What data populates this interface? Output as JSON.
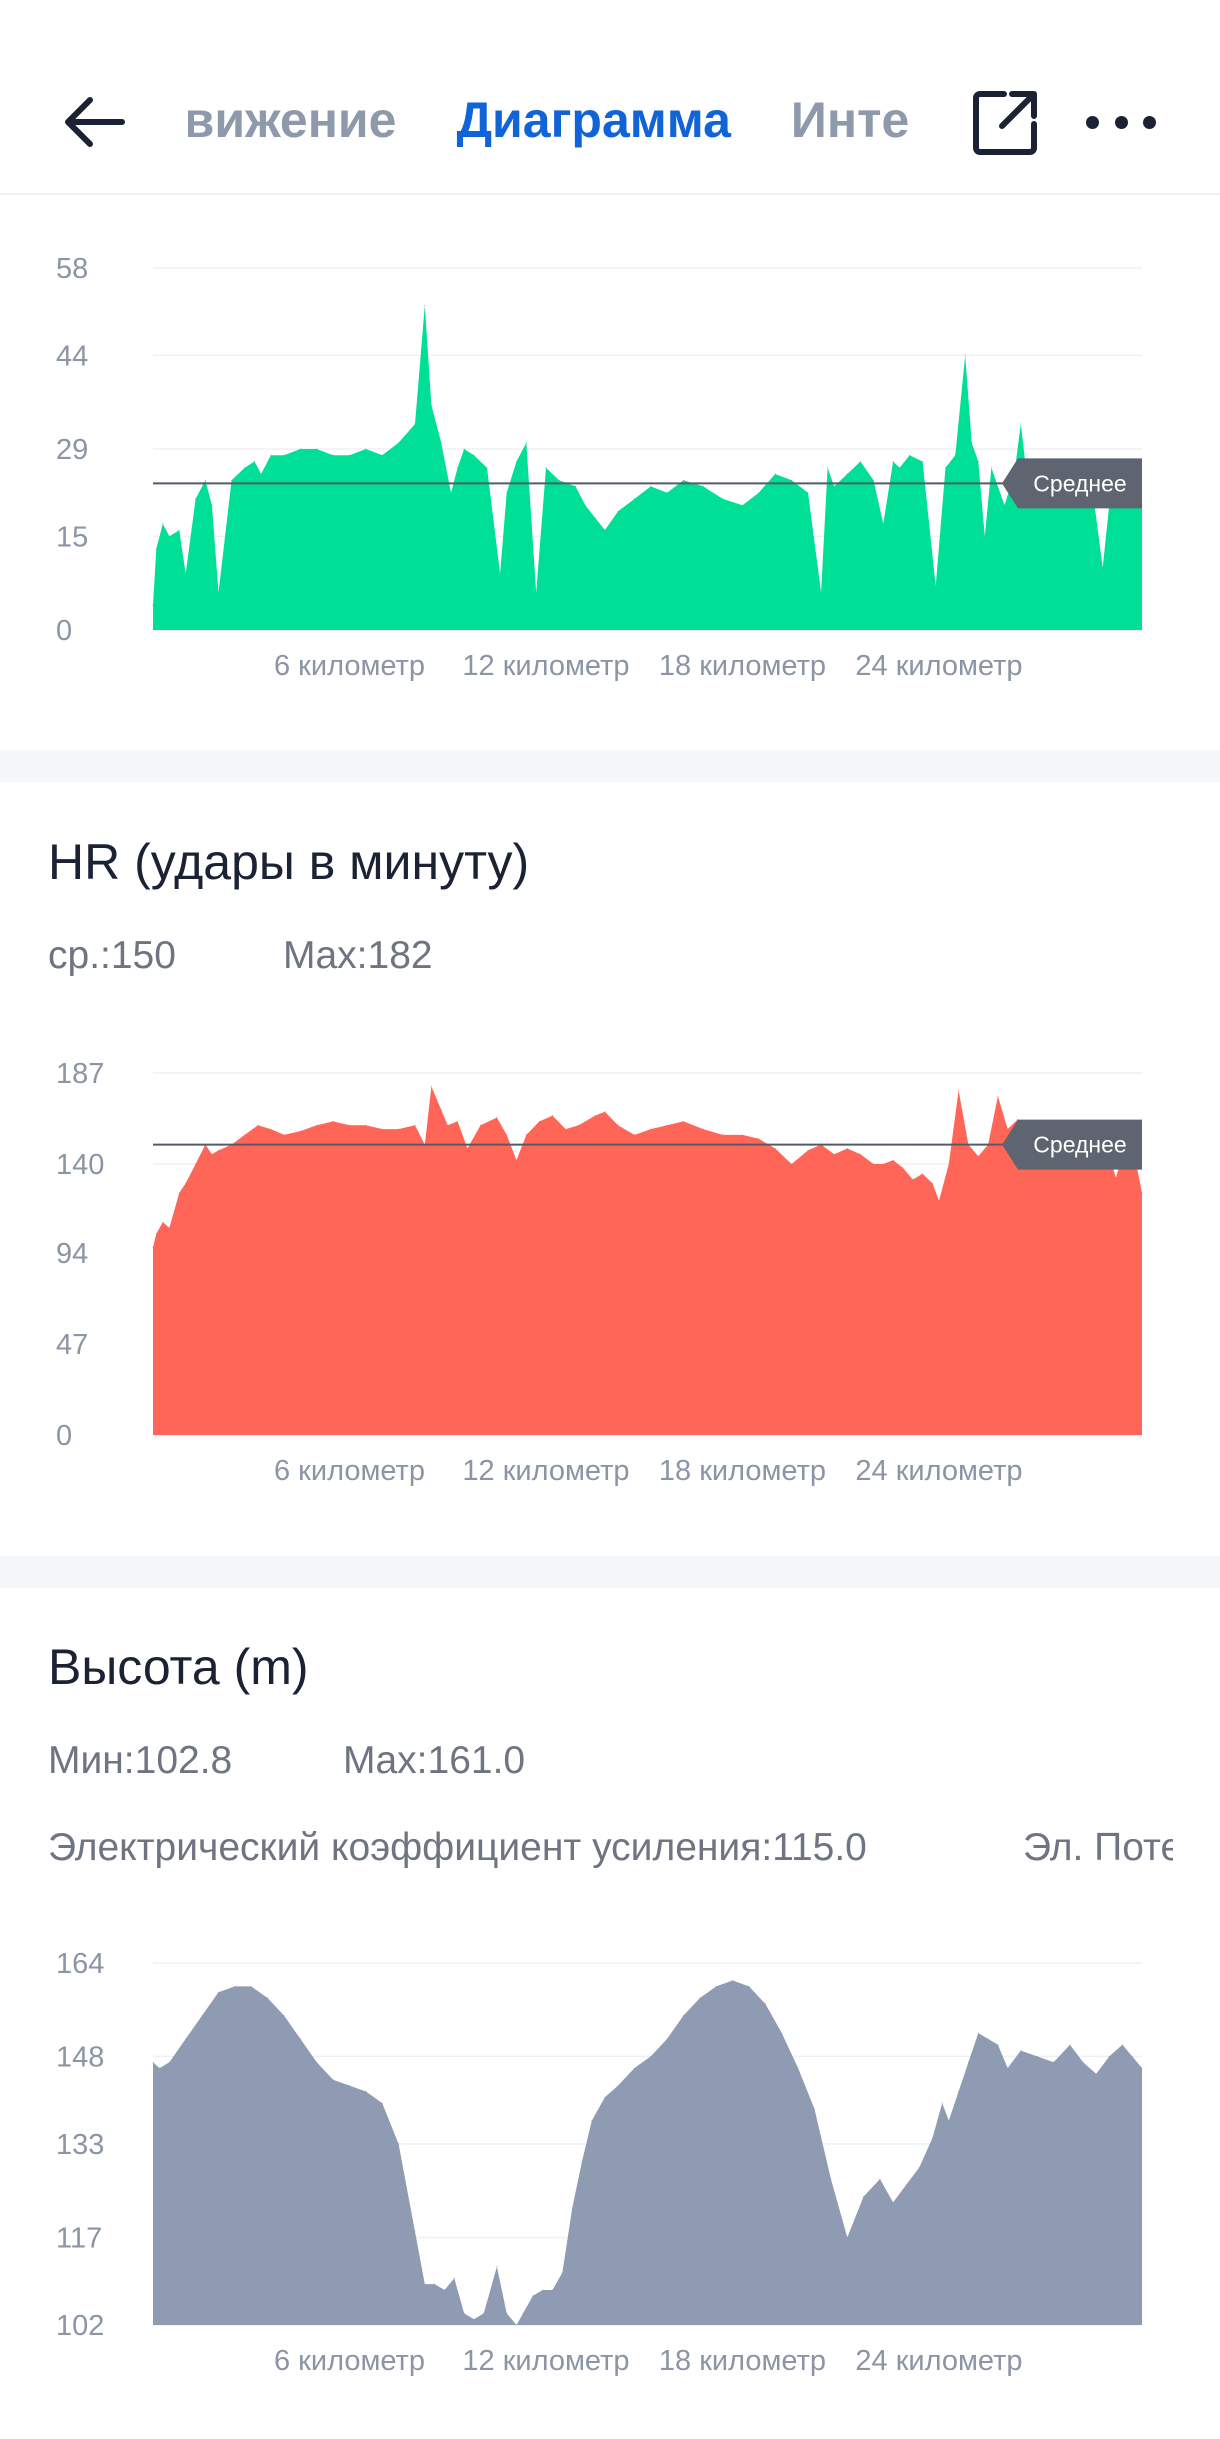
{
  "header": {
    "tabs": [
      {
        "label": "Движение",
        "active": false
      },
      {
        "label": "Диаграмма",
        "active": true
      },
      {
        "label": "Интервалы",
        "active": false
      }
    ],
    "back_icon": "arrow-left-icon",
    "share_icon": "external-share-icon",
    "more_icon": "more-dots-icon"
  },
  "hr": {
    "title": "HR (удары в минуту)",
    "avg_text": "ср.:150",
    "max_text": "Max:182"
  },
  "altitude": {
    "title": "Высота (m)",
    "min_text": "Мин:102.8",
    "max_text": "Max:161.0",
    "gain_text": "Электрический коэффициент усиления:115.0",
    "loss_text": "Эл. Поте"
  },
  "chart_data": [
    {
      "type": "area",
      "id": "speed",
      "color": "#00df96",
      "yticks": [
        0,
        15,
        29,
        44,
        58
      ],
      "ylim": [
        0,
        58
      ],
      "xlim": [
        0,
        30.2
      ],
      "xticks": [
        6,
        12,
        18,
        24
      ],
      "xtick_labels": [
        "6 километр",
        "12 километр",
        "18 километр",
        "24 километр"
      ],
      "average": 23.5,
      "average_label": "Среднее",
      "x": [
        0,
        0.1,
        0.3,
        0.5,
        0.8,
        1.0,
        1.3,
        1.6,
        1.8,
        2.0,
        2.4,
        2.8,
        3.1,
        3.3,
        3.6,
        4.0,
        4.5,
        5.0,
        5.5,
        6.0,
        6.5,
        7.0,
        7.5,
        8.0,
        8.3,
        8.5,
        8.8,
        9.1,
        9.3,
        9.5,
        9.8,
        10.2,
        10.6,
        10.8,
        11.1,
        11.4,
        11.7,
        12.0,
        12.4,
        12.9,
        13.2,
        13.5,
        13.8,
        14.2,
        14.7,
        15.2,
        15.7,
        16.2,
        16.8,
        17.4,
        18.0,
        18.5,
        19.0,
        19.5,
        20.0,
        20.4,
        20.6,
        20.8,
        21.2,
        21.6,
        22.0,
        22.3,
        22.6,
        22.8,
        23.1,
        23.5,
        23.9,
        24.2,
        24.5,
        24.8,
        25.0,
        25.2,
        25.4,
        25.6,
        26.0,
        26.3,
        26.5,
        26.7,
        26.9,
        27.2,
        27.6,
        27.9,
        28.1,
        28.4,
        28.7,
        29.0,
        29.3,
        29.5,
        29.8,
        30.0,
        30.2
      ],
      "y": [
        4,
        13,
        17,
        15,
        16,
        9,
        21,
        24,
        20,
        6,
        24,
        26,
        27,
        25,
        28,
        28,
        29,
        29,
        28,
        28,
        29,
        28,
        30,
        33,
        52,
        36,
        30,
        22,
        26,
        29,
        28,
        26,
        9,
        22,
        27,
        30,
        6,
        26,
        24,
        23,
        20,
        18,
        16,
        19,
        21,
        23,
        22,
        24,
        23,
        21,
        20,
        22,
        25,
        24,
        22,
        6,
        26,
        23,
        25,
        27,
        24,
        17,
        27,
        26,
        28,
        27,
        7,
        26,
        28,
        44,
        30,
        27,
        15,
        26,
        20,
        25,
        33,
        24,
        22,
        24,
        21,
        24,
        20,
        26,
        22,
        10,
        25,
        20,
        24,
        22,
        20
      ]
    },
    {
      "type": "area",
      "id": "hr",
      "color": "#ff6657",
      "yticks": [
        0,
        47,
        94,
        140,
        187
      ],
      "ylim": [
        0,
        187
      ],
      "xlim": [
        0,
        30.2
      ],
      "xticks": [
        6,
        12,
        18,
        24
      ],
      "xtick_labels": [
        "6 километр",
        "12 километр",
        "18 километр",
        "24 километр"
      ],
      "average": 150,
      "average_label": "Среднее",
      "x": [
        0,
        0.1,
        0.3,
        0.5,
        0.8,
        1.0,
        1.3,
        1.6,
        1.8,
        2.0,
        2.4,
        2.8,
        3.2,
        3.6,
        4.0,
        4.5,
        5.0,
        5.5,
        6.0,
        6.5,
        7.0,
        7.5,
        8.0,
        8.3,
        8.5,
        8.8,
        9.0,
        9.3,
        9.6,
        10.0,
        10.5,
        10.8,
        11.1,
        11.4,
        11.8,
        12.2,
        12.6,
        13.0,
        13.5,
        13.8,
        14.2,
        14.7,
        15.2,
        15.7,
        16.2,
        16.8,
        17.4,
        18.0,
        18.5,
        19.0,
        19.5,
        20.0,
        20.4,
        20.8,
        21.2,
        21.6,
        22.0,
        22.3,
        22.6,
        22.9,
        23.2,
        23.5,
        23.8,
        24.0,
        24.3,
        24.6,
        24.9,
        25.2,
        25.5,
        25.8,
        26.1,
        26.4,
        26.7,
        27.0,
        27.3,
        27.7,
        28.0,
        28.4,
        28.8,
        29.1,
        29.4,
        29.7,
        30.0,
        30.2
      ],
      "y": [
        97,
        104,
        110,
        107,
        125,
        130,
        140,
        150,
        145,
        147,
        150,
        155,
        160,
        158,
        155,
        157,
        160,
        162,
        160,
        160,
        158,
        158,
        160,
        150,
        180,
        168,
        160,
        162,
        148,
        160,
        164,
        155,
        142,
        155,
        162,
        165,
        158,
        160,
        165,
        167,
        160,
        155,
        158,
        160,
        162,
        158,
        155,
        155,
        153,
        148,
        140,
        147,
        150,
        145,
        148,
        145,
        140,
        140,
        142,
        138,
        132,
        135,
        130,
        121,
        140,
        178,
        150,
        144,
        150,
        175,
        158,
        163,
        156,
        152,
        152,
        147,
        150,
        145,
        142,
        150,
        133,
        148,
        142,
        125
      ]
    },
    {
      "type": "area",
      "id": "altitude",
      "color": "#8e9bb2",
      "yticks": [
        102,
        117,
        133,
        148,
        164
      ],
      "ylim": [
        102,
        164
      ],
      "xlim": [
        0,
        30.2
      ],
      "xticks": [
        6,
        12,
        18,
        24
      ],
      "xtick_labels": [
        "6 километр",
        "12 километр",
        "18 километр",
        "24 километр"
      ],
      "x": [
        0,
        0.2,
        0.5,
        1.0,
        1.5,
        2.0,
        2.5,
        3.0,
        3.5,
        4.0,
        4.5,
        5.0,
        5.5,
        6.0,
        6.5,
        7.0,
        7.5,
        8.0,
        8.3,
        8.6,
        8.9,
        9.2,
        9.5,
        9.8,
        10.1,
        10.5,
        10.8,
        11.1,
        11.3,
        11.6,
        11.9,
        12.2,
        12.5,
        12.8,
        13.1,
        13.4,
        13.8,
        14.2,
        14.7,
        15.2,
        15.7,
        16.2,
        16.7,
        17.2,
        17.7,
        18.2,
        18.7,
        19.2,
        19.7,
        20.2,
        20.7,
        21.2,
        21.7,
        22.2,
        22.6,
        23.0,
        23.4,
        23.8,
        24.1,
        24.3,
        24.6,
        24.9,
        25.2,
        25.5,
        25.8,
        26.1,
        26.5,
        27.0,
        27.5,
        28.0,
        28.4,
        28.8,
        29.2,
        29.6,
        29.9,
        30.2
      ],
      "y": [
        147,
        146,
        147,
        151,
        155,
        159,
        160,
        160,
        158,
        155,
        151,
        147,
        144,
        143,
        142,
        140,
        133,
        118,
        109,
        109,
        108,
        110,
        104,
        103,
        104,
        112,
        104,
        102,
        104,
        107,
        108,
        108,
        111,
        122,
        130,
        137,
        141,
        143,
        146,
        148,
        151,
        155,
        158,
        160,
        161,
        160,
        157,
        152,
        146,
        139,
        127,
        117,
        124,
        127,
        123,
        126,
        129,
        134,
        140,
        137,
        142,
        147,
        152,
        151,
        150,
        146,
        149,
        148,
        147,
        150,
        147,
        145,
        148,
        150,
        148,
        146
      ]
    }
  ]
}
